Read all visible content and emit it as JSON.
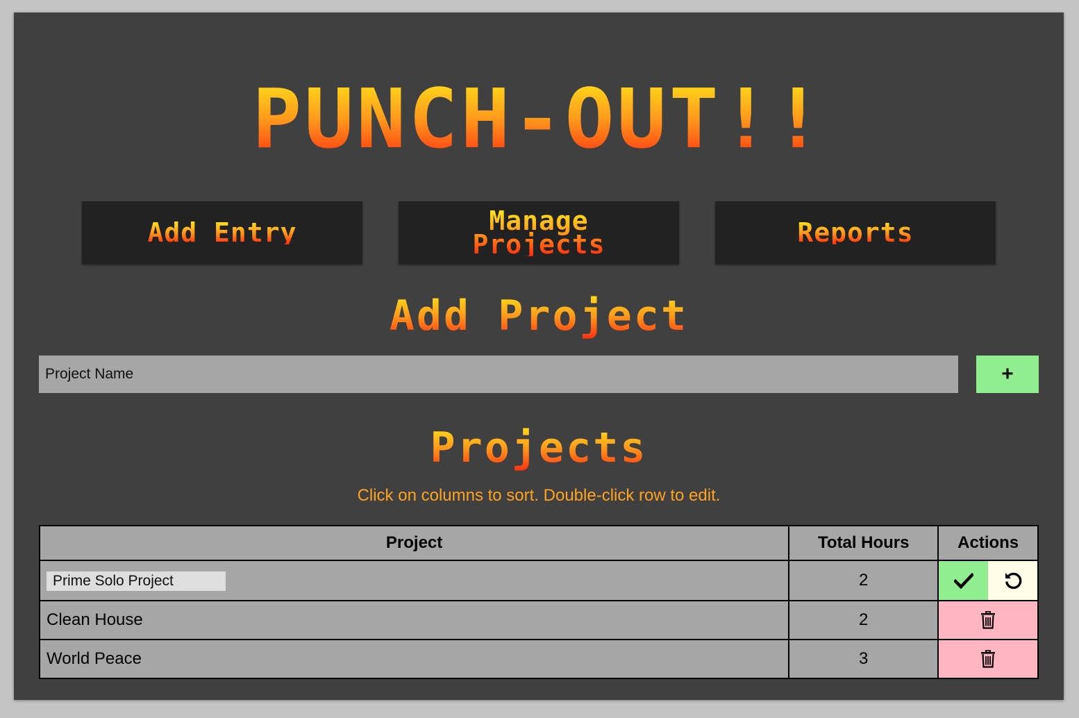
{
  "app": {
    "title": "PUNCH-OUT!!"
  },
  "nav": {
    "items": [
      {
        "label": "Add Entry"
      },
      {
        "label": "Manage\nProjects"
      },
      {
        "label": "Reports"
      }
    ]
  },
  "add_project": {
    "heading": "Add Project",
    "input_placeholder": "Project Name",
    "input_value": "",
    "add_button_label": "+"
  },
  "projects": {
    "heading": "Projects",
    "hint": "Click on columns to sort. Double-click row to edit.",
    "columns": [
      "Project",
      "Total Hours",
      "Actions"
    ],
    "rows": [
      {
        "name": "Prime Solo Project",
        "hours": "2",
        "editing": true,
        "actions": [
          "confirm-icon",
          "revert-icon"
        ]
      },
      {
        "name": "Clean House",
        "hours": "2",
        "editing": false,
        "actions": [
          "trash-icon"
        ]
      },
      {
        "name": "World Peace",
        "hours": "3",
        "editing": false,
        "actions": [
          "trash-icon"
        ]
      }
    ]
  },
  "colors": {
    "background": "#404040",
    "nav_button_bg": "#222222",
    "input_bg": "#a6a6a6",
    "add_button_bg": "#90ee90",
    "hint_text": "#ffa321",
    "delete_bg": "#ffb6c1",
    "confirm_bg": "#90ee90",
    "revert_bg": "#fffde8",
    "title_gradient": [
      "#ffe81a",
      "#ff9a1c",
      "#ff2a10"
    ]
  }
}
